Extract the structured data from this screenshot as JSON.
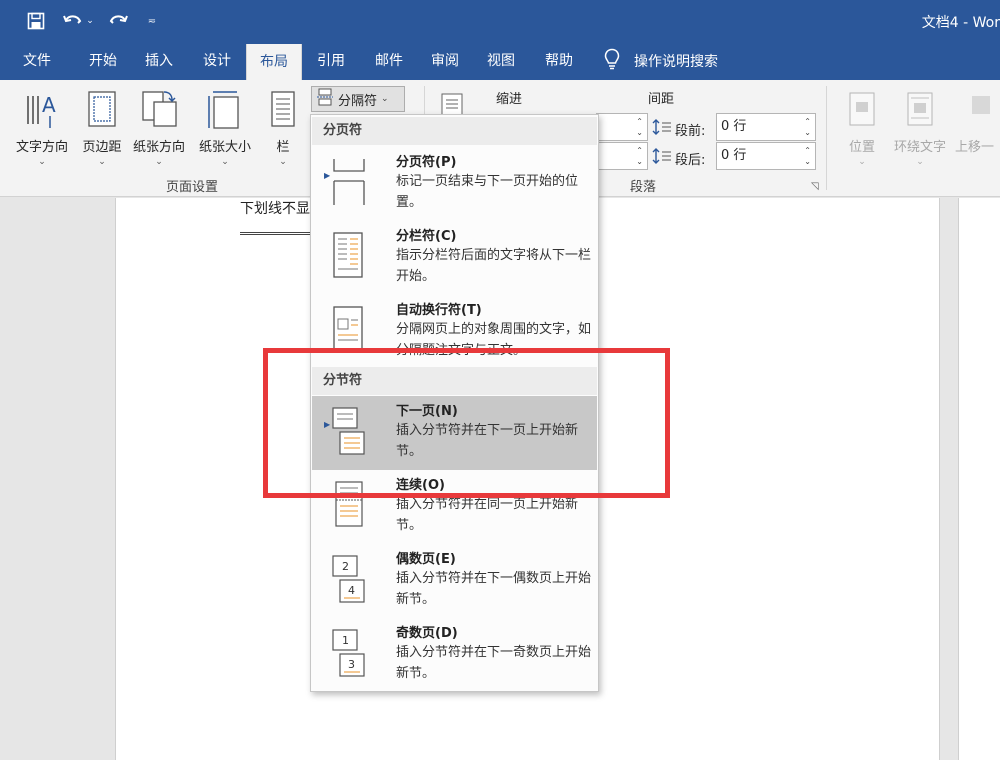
{
  "window": {
    "title": "文档4  -  Wor"
  },
  "qat": {
    "save_icon": "save-icon",
    "undo_icon": "undo-icon",
    "redo_icon": "redo-icon",
    "customize_icon": "customize-qat-icon"
  },
  "tabs": [
    {
      "label": "文件"
    },
    {
      "label": "开始"
    },
    {
      "label": "插入"
    },
    {
      "label": "设计"
    },
    {
      "label": "布局"
    },
    {
      "label": "引用"
    },
    {
      "label": "邮件"
    },
    {
      "label": "审阅"
    },
    {
      "label": "视图"
    },
    {
      "label": "帮助"
    }
  ],
  "active_tab": "布局",
  "tell_me": {
    "label": "操作说明搜索"
  },
  "ribbon": {
    "page_setup": {
      "group_label": "页面设置",
      "buttons": [
        {
          "label": "文字方向"
        },
        {
          "label": "页边距"
        },
        {
          "label": "纸张方向"
        },
        {
          "label": "纸张大小"
        },
        {
          "label": "栏"
        }
      ],
      "breaks_label": "分隔符"
    },
    "paragraph": {
      "group_label": "段落",
      "indent_label": "缩进",
      "spacing_label": "间距",
      "spacing_before_label": "段前:",
      "spacing_before_value": "0 行",
      "spacing_after_label": "段后:",
      "spacing_after_value": "0 行"
    },
    "arrange": {
      "buttons": [
        {
          "label": "位置"
        },
        {
          "label": "环绕文字"
        },
        {
          "label": "上移一"
        }
      ]
    }
  },
  "document": {
    "text_fragment": "下划线不显"
  },
  "breaks_menu": {
    "page_breaks_header": "分页符",
    "section_breaks_header": "分节符",
    "items": [
      {
        "title": "分页符(P)",
        "desc": "标记一页结束与下一页开始的位置。"
      },
      {
        "title": "分栏符(C)",
        "desc": "指示分栏符后面的文字将从下一栏开始。"
      },
      {
        "title": "自动换行符(T)",
        "desc": "分隔网页上的对象周围的文字，如分隔题注文字与正文。"
      },
      {
        "title": "下一页(N)",
        "desc": "插入分节符并在下一页上开始新节。"
      },
      {
        "title": "连续(O)",
        "desc": "插入分节符并在同一页上开始新节。"
      },
      {
        "title": "偶数页(E)",
        "desc": "插入分节符并在下一偶数页上开始新节。"
      },
      {
        "title": "奇数页(D)",
        "desc": "插入分节符并在下一奇数页上开始新节。"
      }
    ],
    "highlighted_item": "下一页(N)"
  },
  "colors": {
    "title_bar": "#2b579a",
    "ribbon_bg": "#f3f3f3",
    "highlight_item": "#c8c8c8",
    "annotation_box": "#e8393b"
  }
}
